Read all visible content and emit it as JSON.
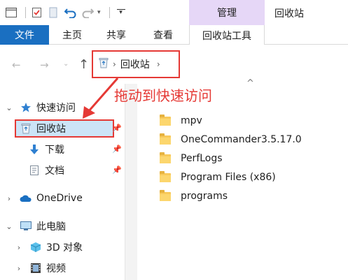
{
  "window": {
    "title": "回收站",
    "manage_tab": "管理"
  },
  "ribbon": {
    "file": "文件",
    "home": "主页",
    "share": "共享",
    "view": "查看",
    "recycle_bin_tools": "回收站工具"
  },
  "address": {
    "crumb": "回收站"
  },
  "annotation": {
    "text": "拖动到快速访问",
    "color": "#e53935"
  },
  "navpane": {
    "quick_access": "快速访问",
    "recycle_bin": "回收站",
    "downloads": "下载",
    "documents": "文档",
    "onedrive": "OneDrive",
    "this_pc": "此电脑",
    "objects_3d": "3D 对象",
    "videos": "视频"
  },
  "files": [
    {
      "name": "mpv"
    },
    {
      "name": "OneCommander3.5.17.0"
    },
    {
      "name": "PerfLogs"
    },
    {
      "name": "Program Files (x86)"
    },
    {
      "name": "programs"
    }
  ],
  "colors": {
    "accent": "#1a6fc1",
    "manage_tab": "#e6d7f7",
    "selection": "#cce4f7",
    "highlight": "#e53935"
  }
}
